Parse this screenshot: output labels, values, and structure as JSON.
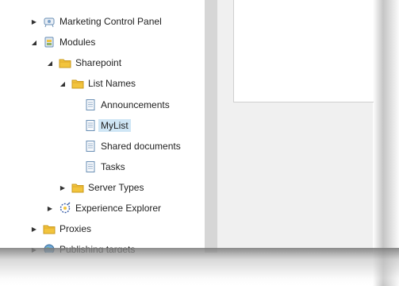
{
  "tree": {
    "items": [
      {
        "label": "Marketing Control Panel",
        "icon": "control-panel-icon",
        "expander": "collapsed"
      },
      {
        "label": "Modules",
        "icon": "modules-icon",
        "expander": "expanded"
      },
      {
        "label": "Sharepoint",
        "icon": "folder-icon",
        "expander": "expanded"
      },
      {
        "label": "List Names",
        "icon": "folder-icon",
        "expander": "expanded"
      },
      {
        "label": "Announcements",
        "icon": "document-icon",
        "expander": "none"
      },
      {
        "label": "MyList",
        "icon": "document-icon",
        "expander": "none",
        "selected": true
      },
      {
        "label": "Shared documents",
        "icon": "document-icon",
        "expander": "none"
      },
      {
        "label": "Tasks",
        "icon": "document-icon",
        "expander": "none"
      },
      {
        "label": "Server Types",
        "icon": "folder-icon",
        "expander": "collapsed"
      },
      {
        "label": "Experience Explorer",
        "icon": "experience-explorer-icon",
        "expander": "collapsed"
      },
      {
        "label": "Proxies",
        "icon": "folder-icon",
        "expander": "collapsed"
      },
      {
        "label": "Publishing targets",
        "icon": "globe-icon",
        "expander": "collapsed"
      }
    ]
  },
  "colors": {
    "selection": "#cfe6f5",
    "folder": "#f2c43d",
    "splitter": "#d6d6d6"
  }
}
